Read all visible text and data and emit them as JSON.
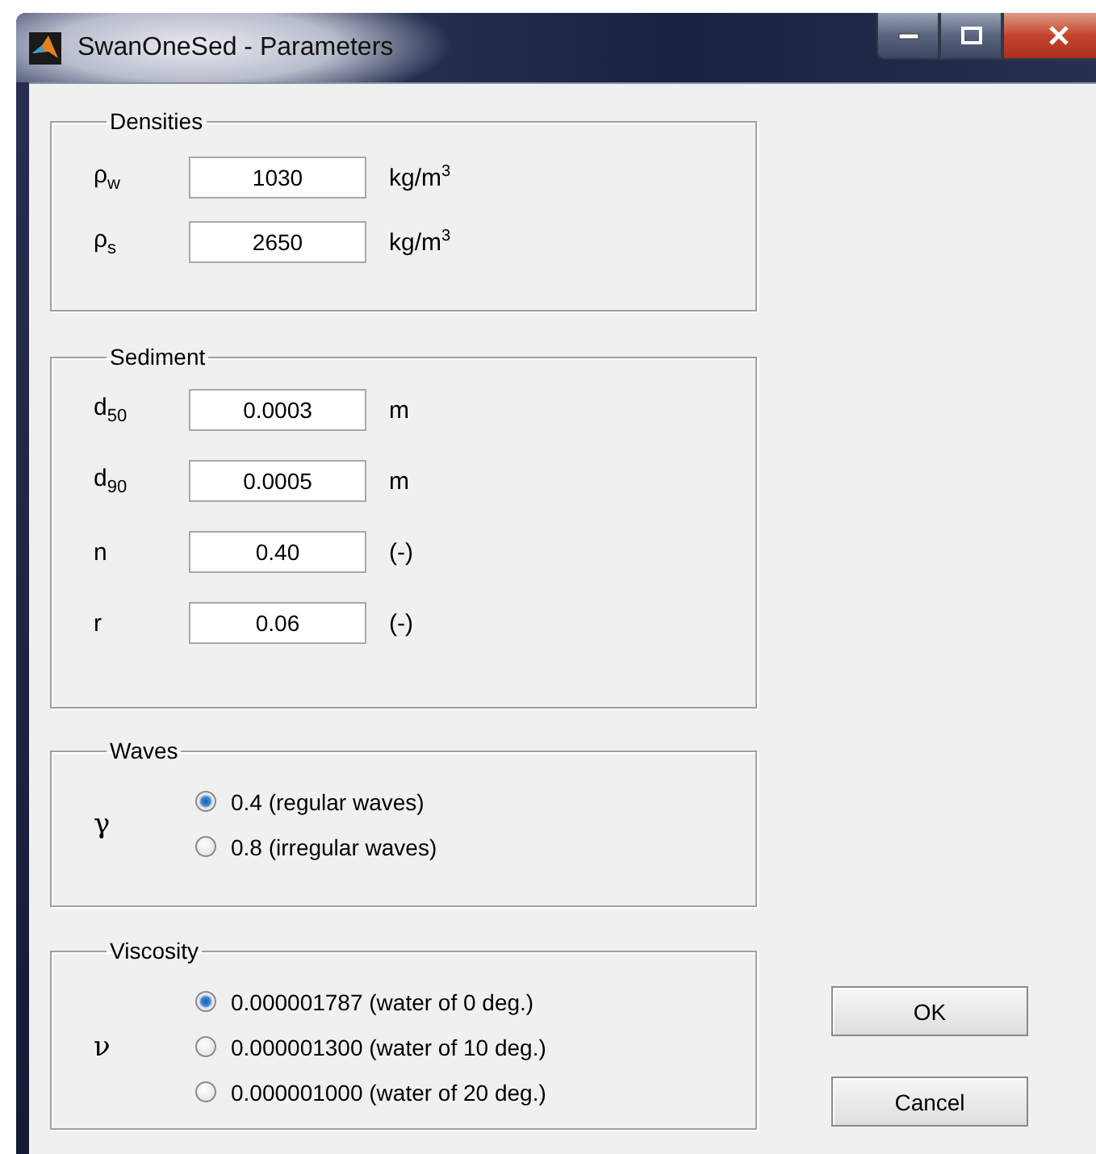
{
  "window": {
    "title": "SwanOneSed - Parameters"
  },
  "groups": [
    {
      "title": "Densities",
      "kind": "fields",
      "rows": [
        {
          "symbol": "ρ$_{w}$",
          "value": "1030",
          "unit": "kg/m$^{3}$"
        },
        {
          "symbol": "ρ$_{s}$",
          "value": "2650",
          "unit": "kg/m$^{3}$"
        }
      ]
    },
    {
      "title": "Sediment",
      "kind": "fields",
      "rows": [
        {
          "symbol": "d$_{50}$",
          "value": "0.0003",
          "unit": "m"
        },
        {
          "symbol": "d$_{90}$",
          "value": "0.0005",
          "unit": "m"
        },
        {
          "symbol": "n",
          "value": "0.40",
          "unit": "(-)"
        },
        {
          "symbol": "r",
          "value": "0.06",
          "unit": "(-)"
        }
      ]
    },
    {
      "title": "Waves",
      "kind": "radios",
      "symbol": "γ",
      "options": [
        {
          "label": "0.4 (regular waves)",
          "selected": true
        },
        {
          "label": "0.8 (irregular waves)",
          "selected": false
        }
      ]
    },
    {
      "title": "Viscosity",
      "kind": "radios",
      "symbol": "ν",
      "options": [
        {
          "label": "0.000001787 (water of 0 deg.)",
          "selected": true
        },
        {
          "label": "0.000001300 (water of 10 deg.)",
          "selected": false
        },
        {
          "label": "0.000001000 (water of 20 deg.)",
          "selected": false
        }
      ]
    }
  ],
  "buttons": [
    "OK",
    "Cancel"
  ]
}
